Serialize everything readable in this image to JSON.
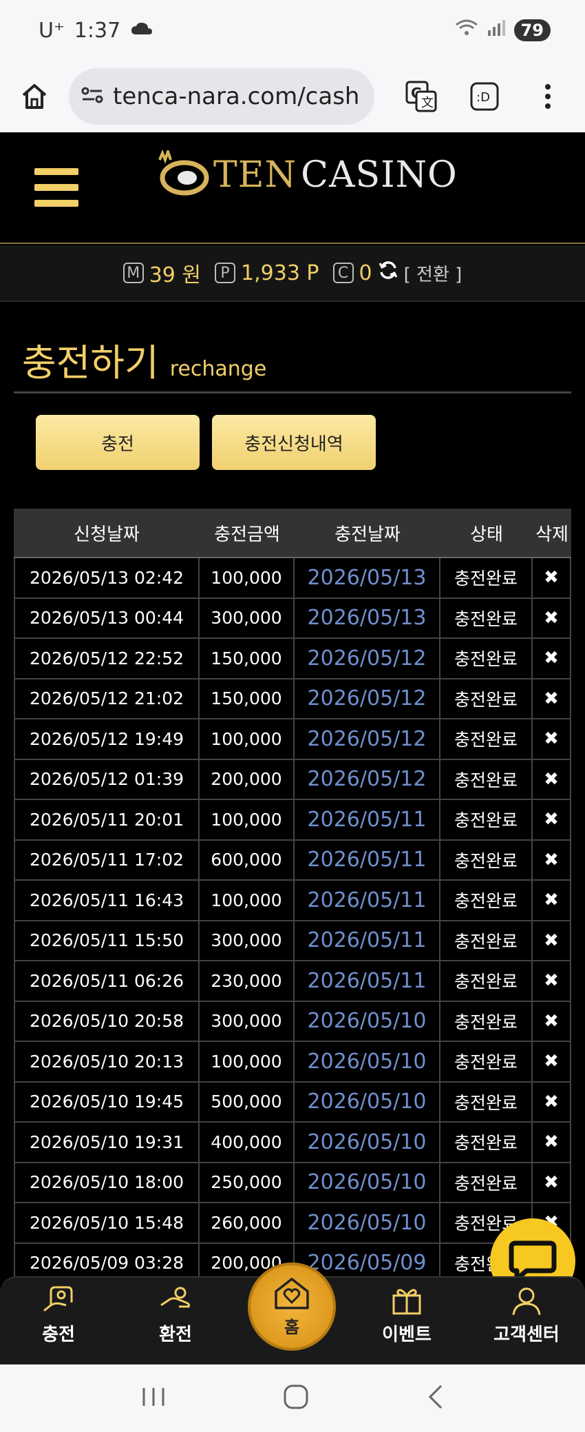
{
  "status_bar": {
    "carrier": "U⁺",
    "time": "1:37",
    "battery": "79"
  },
  "browser": {
    "url": "tenca-nara.com/cash"
  },
  "site": {
    "logo_ten": "TEN",
    "logo_casino": "CASINO"
  },
  "balance": {
    "money_badge": "M",
    "money": "39 원",
    "point_badge": "P",
    "points": "1,933 P",
    "coin_badge": "C",
    "coins": "0",
    "switch_label": "[ 전환 ]"
  },
  "page": {
    "title_ko": "충전하기",
    "title_en": "rechange"
  },
  "buttons": {
    "charge": "충전",
    "history": "충전신청내역"
  },
  "table": {
    "headers": [
      "신청날짜",
      "충전금액",
      "충전날짜",
      "상태",
      "삭제"
    ],
    "rows": [
      {
        "req": "2026/05/13 02:42",
        "amount": "100,000",
        "date": "2026/05/13",
        "status": "충전완료",
        "del": "✖"
      },
      {
        "req": "2026/05/13 00:44",
        "amount": "300,000",
        "date": "2026/05/13",
        "status": "충전완료",
        "del": "✖"
      },
      {
        "req": "2026/05/12 22:52",
        "amount": "150,000",
        "date": "2026/05/12",
        "status": "충전완료",
        "del": "✖"
      },
      {
        "req": "2026/05/12 21:02",
        "amount": "150,000",
        "date": "2026/05/12",
        "status": "충전완료",
        "del": "✖"
      },
      {
        "req": "2026/05/12 19:49",
        "amount": "100,000",
        "date": "2026/05/12",
        "status": "충전완료",
        "del": "✖"
      },
      {
        "req": "2026/05/12 01:39",
        "amount": "200,000",
        "date": "2026/05/12",
        "status": "충전완료",
        "del": "✖"
      },
      {
        "req": "2026/05/11 20:01",
        "amount": "100,000",
        "date": "2026/05/11",
        "status": "충전완료",
        "del": "✖"
      },
      {
        "req": "2026/05/11 17:02",
        "amount": "600,000",
        "date": "2026/05/11",
        "status": "충전완료",
        "del": "✖"
      },
      {
        "req": "2026/05/11 16:43",
        "amount": "100,000",
        "date": "2026/05/11",
        "status": "충전완료",
        "del": "✖"
      },
      {
        "req": "2026/05/11 15:50",
        "amount": "300,000",
        "date": "2026/05/11",
        "status": "충전완료",
        "del": "✖"
      },
      {
        "req": "2026/05/11 06:26",
        "amount": "230,000",
        "date": "2026/05/11",
        "status": "충전완료",
        "del": "✖"
      },
      {
        "req": "2026/05/10 20:58",
        "amount": "300,000",
        "date": "2026/05/10",
        "status": "충전완료",
        "del": "✖"
      },
      {
        "req": "2026/05/10 20:13",
        "amount": "100,000",
        "date": "2026/05/10",
        "status": "충전완료",
        "del": "✖"
      },
      {
        "req": "2026/05/10 19:45",
        "amount": "500,000",
        "date": "2026/05/10",
        "status": "충전완료",
        "del": "✖"
      },
      {
        "req": "2026/05/10 19:31",
        "amount": "400,000",
        "date": "2026/05/10",
        "status": "충전완료",
        "del": "✖"
      },
      {
        "req": "2026/05/10 18:00",
        "amount": "250,000",
        "date": "2026/05/10",
        "status": "충전완료",
        "del": "✖"
      },
      {
        "req": "2026/05/10 15:48",
        "amount": "260,000",
        "date": "2026/05/10",
        "status": "충전완료",
        "del": "✖"
      },
      {
        "req": "2026/05/09 03:28",
        "amount": "200,000",
        "date": "2026/05/09",
        "status": "충전완료",
        "del": "✖"
      }
    ]
  },
  "bottom_nav": {
    "charge": "충전",
    "exchange": "환전",
    "home": "홈",
    "event": "이벤트",
    "support": "고객센터"
  },
  "colors": {
    "gold": "#f2cf67",
    "link_blue": "#6f8fce",
    "chat_yellow": "#f7c81f"
  }
}
